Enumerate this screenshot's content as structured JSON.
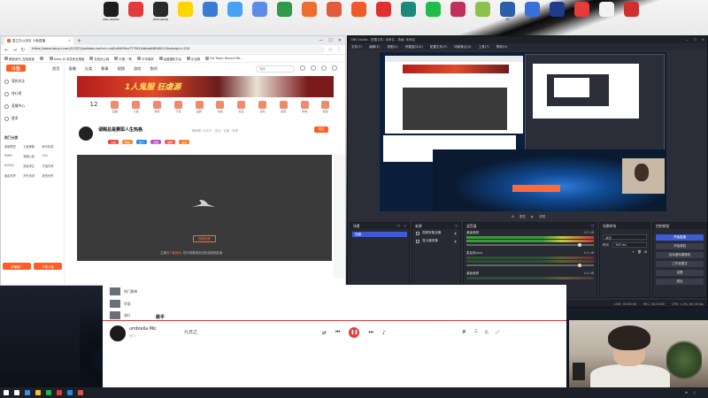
{
  "desktop": {
    "icons": [
      {
        "label": "obs-studio",
        "color": "#1e1e1e"
      },
      {
        "label": "",
        "color": "#e23b3b"
      },
      {
        "label": "Alienware",
        "color": "#2a2a2a"
      },
      {
        "label": "",
        "color": "#ffd400"
      },
      {
        "label": "",
        "color": "#3a7bd5"
      },
      {
        "label": "",
        "color": "#47a1f5"
      },
      {
        "label": "",
        "color": "#5b8de6"
      },
      {
        "label": "",
        "color": "#2e9a4a"
      },
      {
        "label": "",
        "color": "#f06c2f"
      },
      {
        "label": "",
        "color": "#e35b3a"
      },
      {
        "label": "",
        "color": "#ee5a2a"
      },
      {
        "label": "",
        "color": "#e22f2f"
      },
      {
        "label": "",
        "color": "#1a8a7a"
      },
      {
        "label": "",
        "color": "#1fbe4a"
      },
      {
        "label": "",
        "color": "#c12f5b"
      },
      {
        "label": "",
        "color": "#8bc34a"
      },
      {
        "label": "SE",
        "color": "#2d5fa8"
      },
      {
        "label": "K",
        "color": "#3a6fd8"
      },
      {
        "label": "",
        "color": "#1e3c8a"
      },
      {
        "label": "",
        "color": "#e53b3b"
      },
      {
        "label": "",
        "color": "#f2f2f2"
      },
      {
        "label": "",
        "color": "#d02f2f"
      }
    ]
  },
  "browser": {
    "tab_title": "直立办公战队 斗鱼直播",
    "address": "https://www.douyu.com/12337/grafabis-tarfrrrc=zb2ofhftl5zx777f010ldbabi48000110odsrip/c=210",
    "bookmarks": [
      "微信读书_在线阅读",
      "",
      "Kimo-AI 浏览安全搜索",
      "在线办公网",
      "乐搜-一条",
      "中华城邦",
      "运营通知平台",
      "乐活网",
      "Grt Tools, Record Re..."
    ],
    "top_nav": [
      "首页",
      "直播",
      "分类",
      "赛事",
      "视频",
      "游戏",
      "鱼吧"
    ],
    "search_placeholder": "搜索",
    "sidebar": {
      "logo": "斗鱼",
      "items": [
        "我的关注",
        "排行榜",
        "直播中心",
        "更多"
      ],
      "section_title": "热门分类",
      "categories": [
        "英雄联盟",
        "王者荣耀",
        "和平精英",
        "PUBG",
        "穿越火线",
        "CS2",
        "DOTA2",
        "绝地求生",
        "守望先锋",
        "魔兽世界",
        "炉石传说",
        "我的世界"
      ],
      "btn_start": "开播推广",
      "btn_download": "下载斗鱼"
    },
    "banner_text": "1人鬼服 狂虐源",
    "icon_row": {
      "count": "12",
      "labels": [
        "",
        "直播",
        "斗鱼",
        "游戏",
        "下载",
        "品牌",
        "动态",
        "社区",
        "活动",
        "鱼吧",
        "商城",
        "更多"
      ]
    },
    "streamer": {
      "title": "请赐总是赛耶人生热格",
      "meta": "房间号: 12337 · 关注 · 订阅 · 分享",
      "tags": [
        {
          "text": "主播",
          "color": "#e6473f"
        },
        {
          "text": "粉丝",
          "color": "#f08a2c"
        },
        {
          "text": "热门",
          "color": "#2b8ce6"
        },
        {
          "text": "直播",
          "color": "#c04fc7"
        },
        {
          "text": "福利",
          "color": "#f05d4f"
        },
        {
          "text": "活动",
          "color": "#ff7b1f"
        }
      ],
      "follow": "关注"
    },
    "player": {
      "offline_btn": "视频回放",
      "offline_prefix": "主播已",
      "offline_em": "下播房间",
      "offline_suffix": ", 您可观看精彩回放或推荐直播"
    }
  },
  "obs": {
    "title": "OBS Studio - 配置文件: 未命名 - 场景: 未命名",
    "menu": [
      "文件(F)",
      "编辑(E)",
      "视图(V)",
      "停靠窗口(D)",
      "配置文件(P)",
      "场景集合(S)",
      "工具(T)",
      "帮助(H)"
    ],
    "tabs": [
      "属性",
      "滤镜"
    ],
    "docks": {
      "scenes": {
        "title": "场景",
        "items": [
          "场景"
        ]
      },
      "sources": {
        "title": "来源",
        "items": [
          "视频采集设备",
          "显示器采集"
        ]
      },
      "mixer": {
        "title": "混音器",
        "channels": [
          {
            "name": "桌面音频",
            "db": "0.0 dB"
          },
          {
            "name": "麦克风/Aux",
            "db": "0.0 dB"
          },
          {
            "name": "桌面音频",
            "db": "0.0 dB"
          }
        ]
      },
      "transitions": {
        "title": "场景转场",
        "rows": [
          {
            "label": "淡出",
            "value": "淡出"
          },
          {
            "label": "时长",
            "value": "300 ms"
          }
        ]
      },
      "controls": {
        "title": "控制按钮",
        "buttons": [
          "开始直播",
          "开始录制",
          "启动虚拟摄像机",
          "工作室模式",
          "设置",
          "退出"
        ]
      }
    },
    "status": {
      "live": "LIVE: 00:00:00",
      "rec": "REC: 00:00:00",
      "cpu": "CPU: 1.4%, 60.00 fps"
    }
  },
  "music": {
    "section": "歌手",
    "song": "umbrella  Mic",
    "artist": "热门",
    "desc": "九日之",
    "lyric": "乐",
    "playlist_labels": [
      "热门歌单",
      "华语",
      "流行"
    ]
  },
  "taskbar": {
    "clock": "",
    "colors": [
      "#ffffff",
      "#3a8ee6",
      "#f2c230",
      "#26b34a",
      "#e63b3b",
      "#1e8ae6",
      "#d9534f"
    ]
  }
}
